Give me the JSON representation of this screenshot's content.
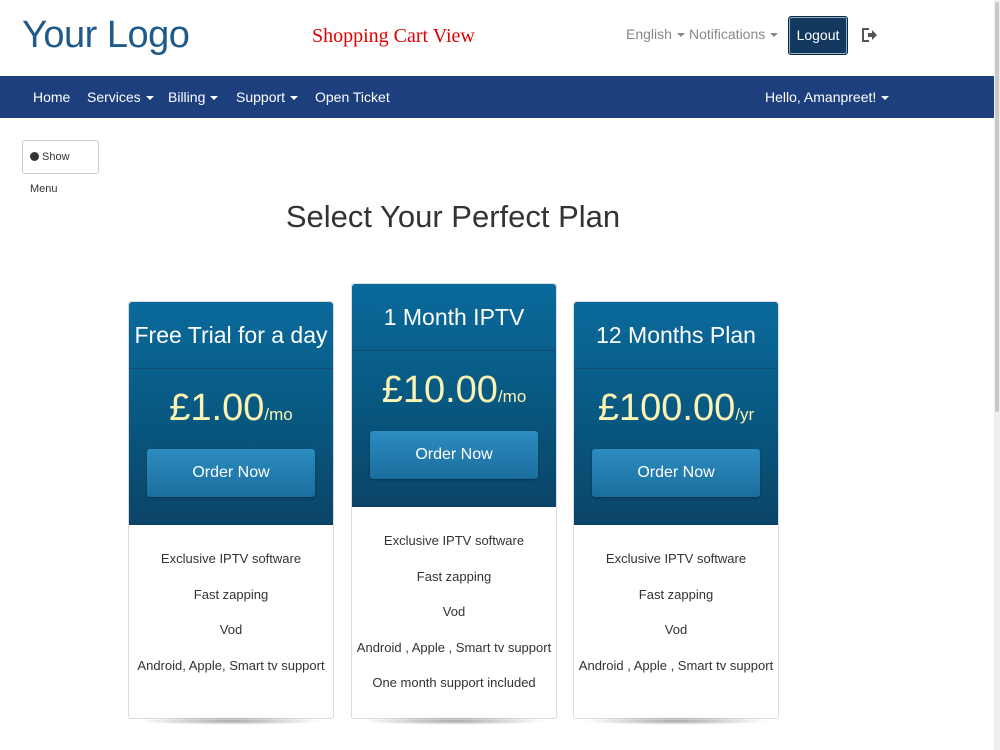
{
  "header": {
    "logo": "Your Logo",
    "page_label": "Shopping Cart View",
    "language": "English",
    "notifications": "Notifications",
    "logout": "Logout"
  },
  "nav": {
    "items": [
      "Home",
      "Services",
      "Billing",
      "Support",
      "Open Ticket"
    ],
    "greeting": "Hello, Amanpreet!"
  },
  "show_menu": "Show Menu",
  "page_title": "Select Your Perfect Plan",
  "plans": [
    {
      "title": "Free Trial for a day",
      "price": "£1.00",
      "unit": "/mo",
      "button": "Order Now",
      "features": [
        "Exclusive IPTV software",
        "Fast zapping",
        "Vod",
        "Android, Apple, Smart tv support"
      ]
    },
    {
      "title": "1 Month IPTV",
      "price": "£10.00",
      "unit": "/mo",
      "button": "Order Now",
      "features": [
        "Exclusive IPTV software",
        "Fast zapping",
        "Vod",
        "Android , Apple , Smart tv support",
        "One month support included"
      ]
    },
    {
      "title": "12 Months Plan",
      "price": "£100.00",
      "unit": "/yr",
      "button": "Order Now",
      "features": [
        "Exclusive IPTV software",
        "Fast zapping",
        "Vod",
        "Android , Apple , Smart tv support"
      ]
    }
  ],
  "colors": {
    "navbar": "#1d3f7e",
    "logo": "#1f5a8a",
    "page_label": "#e00000",
    "card_header": "#08577f",
    "price_text": "#fbf3b3",
    "logout_button": "#13395f"
  }
}
